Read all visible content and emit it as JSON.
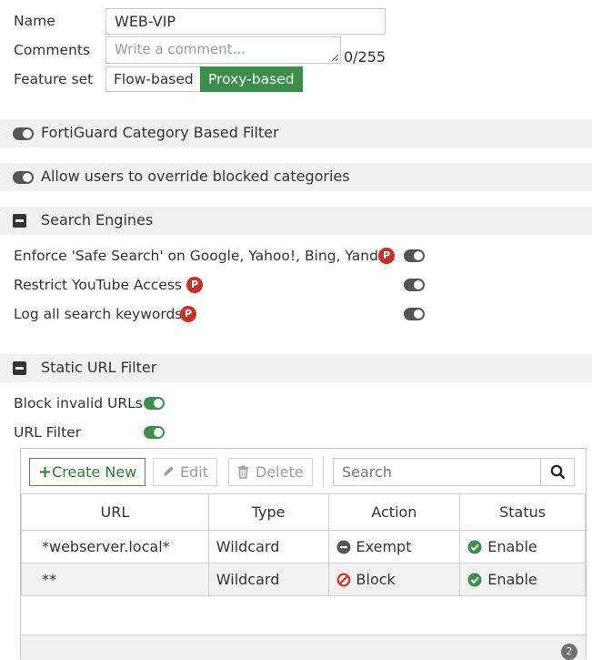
{
  "form": {
    "name_label": "Name",
    "name_value": "WEB-VIP",
    "comments_label": "Comments",
    "comments_placeholder": "Write a comment...",
    "comments_counter": "0/255",
    "feature_set_label": "Feature set",
    "feature_set_options": [
      "Flow-based",
      "Proxy-based"
    ],
    "feature_set_selected": "Proxy-based"
  },
  "fortiguard": {
    "title": "FortiGuard Category Based Filter",
    "enabled": false
  },
  "override": {
    "title": "Allow users to override blocked categories",
    "enabled": false
  },
  "search_engines": {
    "title": "Search Engines",
    "items": [
      {
        "label": "Enforce 'Safe Search' on Google, Yahoo!, Bing, Yandex",
        "badge": "P",
        "enabled": false
      },
      {
        "label": "Restrict YouTube Access",
        "badge": "P",
        "enabled": false
      },
      {
        "label": "Log all search keywords",
        "badge": "P",
        "enabled": false
      }
    ]
  },
  "static_url": {
    "title": "Static URL Filter",
    "block_invalid_label": "Block invalid URLs",
    "block_invalid_enabled": true,
    "url_filter_label": "URL Filter",
    "url_filter_enabled": true
  },
  "toolbar": {
    "create_label": "Create New",
    "edit_label": "Edit",
    "delete_label": "Delete",
    "search_placeholder": "Search"
  },
  "table": {
    "columns": [
      "URL",
      "Type",
      "Action",
      "Status"
    ],
    "rows": [
      {
        "url": "*webserver.local*",
        "type": "Wildcard",
        "action": "Exempt",
        "status": "Enable"
      },
      {
        "url": "**",
        "type": "Wildcard",
        "action": "Block",
        "status": "Enable"
      }
    ],
    "count": "2"
  },
  "colors": {
    "accent_green": "#3c8f4a",
    "badge_red": "#c8312a",
    "block_red": "#d9302a"
  }
}
